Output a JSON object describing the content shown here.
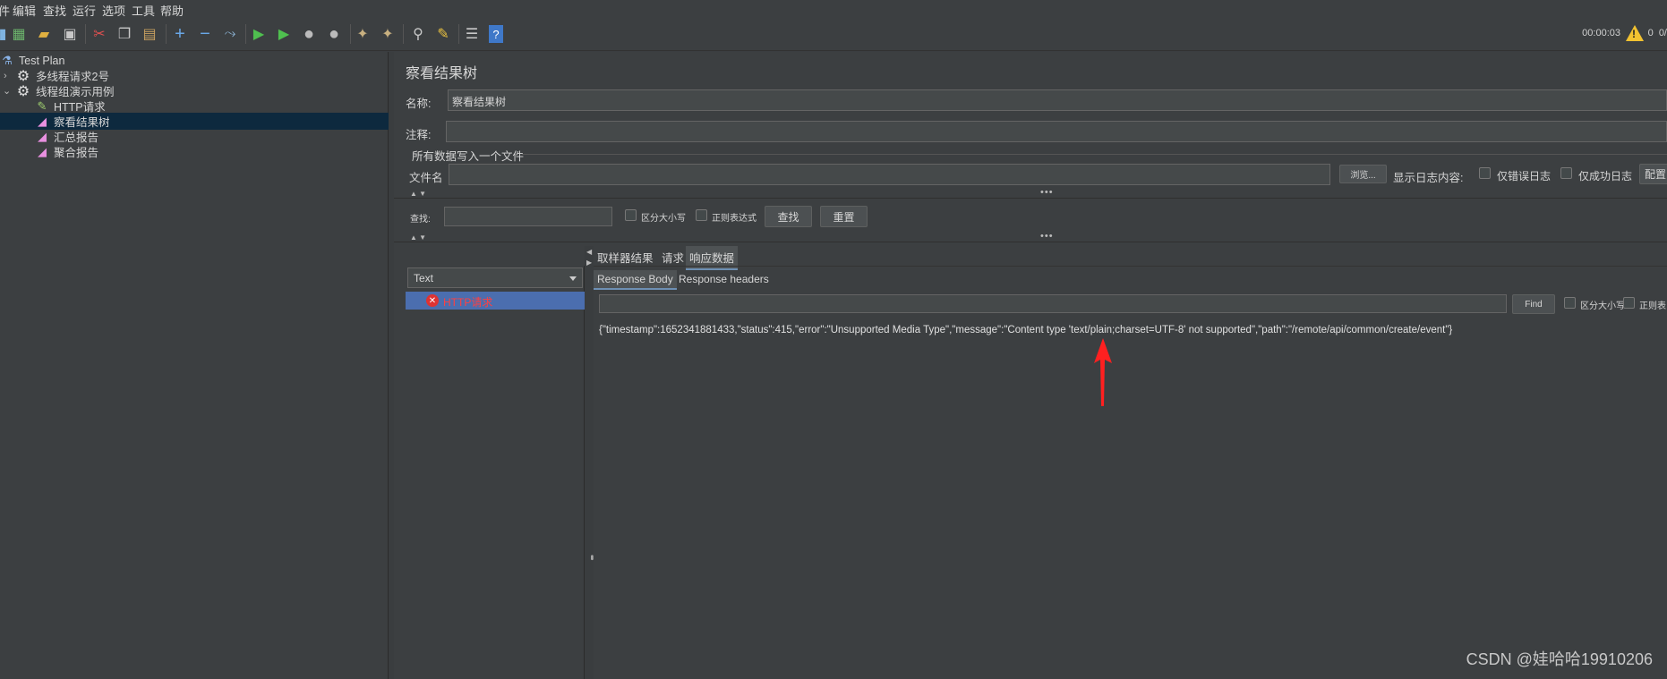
{
  "menu": [
    "件",
    "编辑",
    "查找",
    "运行",
    "选项",
    "工具",
    "帮助"
  ],
  "toolbar": {
    "icons": [
      "new-template-icon",
      "open-icon",
      "save-icon",
      "cut-icon",
      "copy-icon",
      "paste-icon",
      "add-icon",
      "remove-icon",
      "toggle-icon",
      "start-icon",
      "start-no-pause-icon",
      "stop-icon",
      "shutdown-icon",
      "clear-icon",
      "clear-all-icon",
      "search-icon",
      "reset-search-icon",
      "function-helper-icon",
      "help-icon"
    ],
    "timer": "00:00:03",
    "warn_count": "0",
    "thread_count": "0/"
  },
  "tree": {
    "items": [
      {
        "label": "Test Plan",
        "icon": "test-plan-icon"
      },
      {
        "label": "多线程请求2号",
        "icon": "thread-group-icon",
        "arrow": ">"
      },
      {
        "label": "线程组演示用例",
        "icon": "thread-group-icon",
        "arrow": "v"
      },
      {
        "label": "HTTP请求",
        "icon": "http-sampler-icon"
      },
      {
        "label": "察看结果树",
        "icon": "listener-icon"
      },
      {
        "label": "汇总报告",
        "icon": "listener-icon"
      },
      {
        "label": "聚合报告",
        "icon": "listener-icon"
      }
    ]
  },
  "panel": {
    "title": "察看结果树",
    "name_label": "名称:",
    "name_value": "察看结果树",
    "comment_label": "注释:",
    "comment_value": "",
    "file_section": "所有数据写入一个文件",
    "file_label": "文件名",
    "file_value": "",
    "browse_label": "浏览...",
    "log_display_label": "显示日志内容:",
    "errors_only_label": "仅错误日志",
    "success_only_label": "仅成功日志",
    "configure_label": "配置",
    "search_label": "查找:",
    "search_value": "",
    "case_label": "区分大小写",
    "regex_label": "正则表达式",
    "find_button": "查找",
    "reset_button": "重置"
  },
  "results": {
    "renderer": "Text",
    "items": [
      {
        "label": "HTTP请求",
        "status": "error"
      }
    ]
  },
  "detail": {
    "tabs": [
      "取样器结果",
      "请求",
      "响应数据"
    ],
    "active_tab": "响应数据",
    "subtabs": [
      "Response Body",
      "Response headers"
    ],
    "active_subtab": "Response Body",
    "find_value": "",
    "find_button": "Find",
    "case_label": "区分大小写",
    "regex_label": "正则表",
    "response_body": "{\"timestamp\":1652341881433,\"status\":415,\"error\":\"Unsupported Media Type\",\"message\":\"Content type 'text/plain;charset=UTF-8' not supported\",\"path\":\"/remote/api/common/create/event\"}"
  },
  "watermark": "CSDN @娃哈哈19910206",
  "colors": {
    "selection": "#0d293e",
    "result_selected": "#4b6eaf",
    "error_text": "#ff4040",
    "annotation": "#ff2020"
  }
}
